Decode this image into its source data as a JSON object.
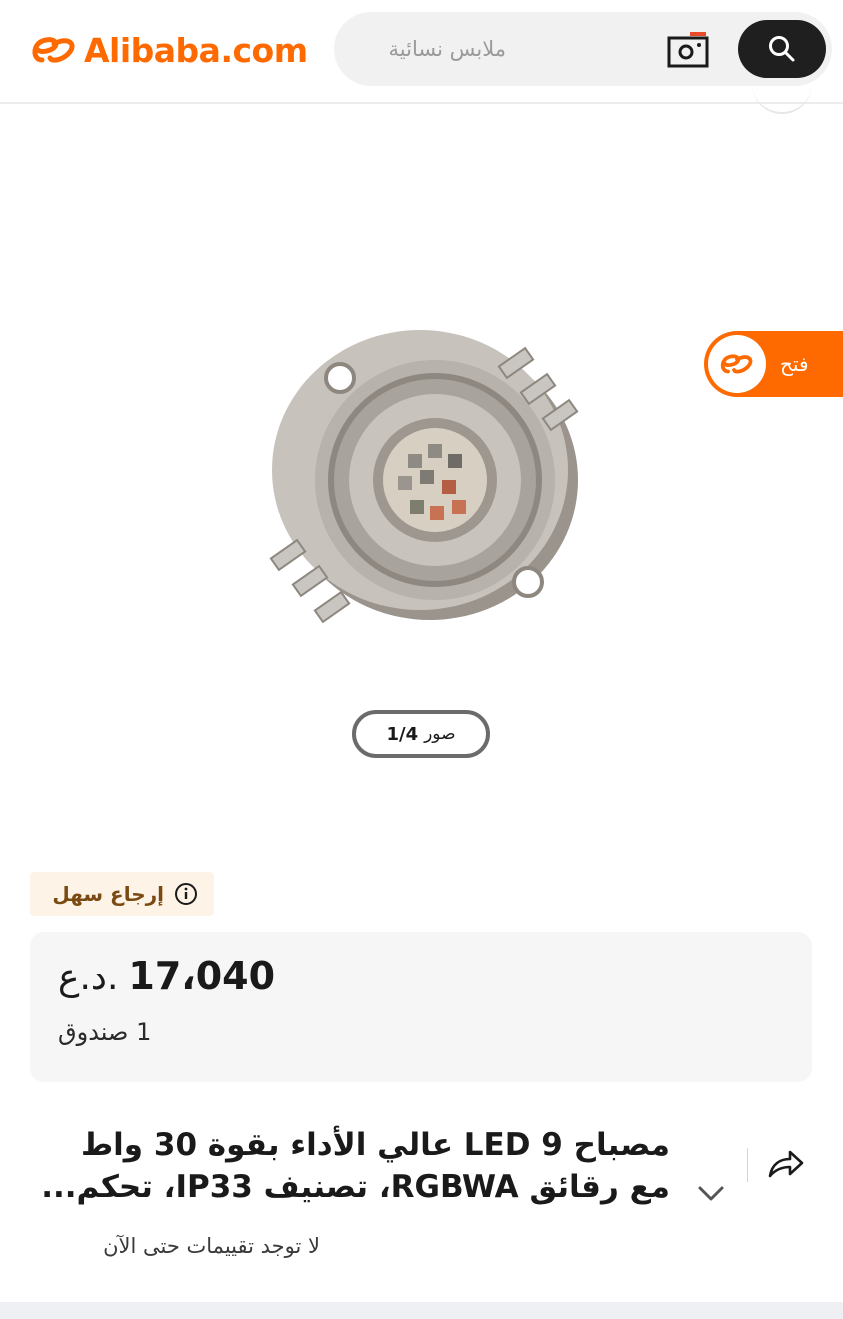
{
  "header": {
    "brand": "Alibaba.com",
    "search_placeholder": "ملابس نسائية",
    "camera_icon": "camera-icon",
    "search_icon": "search-icon"
  },
  "product": {
    "image_alt": "LED chip",
    "open_app_label": "فتح",
    "photo_counter_label": "صور",
    "photo_counter_value": "1/4",
    "easy_return_label": "إرجاع سهل",
    "price_value": "17،040",
    "price_currency": "د.ع.",
    "moq": "1 صندوق",
    "title": "مصباح LED 9 عالي الأداء بقوة 30 واط مع رقائق RGBWA، تصنيف IP33، تحكم...",
    "reviews": "لا توجد تقييمات حتى الآن"
  },
  "colors": {
    "brand": "#ff6a00",
    "search_button": "#1f1f1f",
    "return_badge_bg": "#fdf3e6",
    "return_badge_text": "#7a4a12"
  }
}
